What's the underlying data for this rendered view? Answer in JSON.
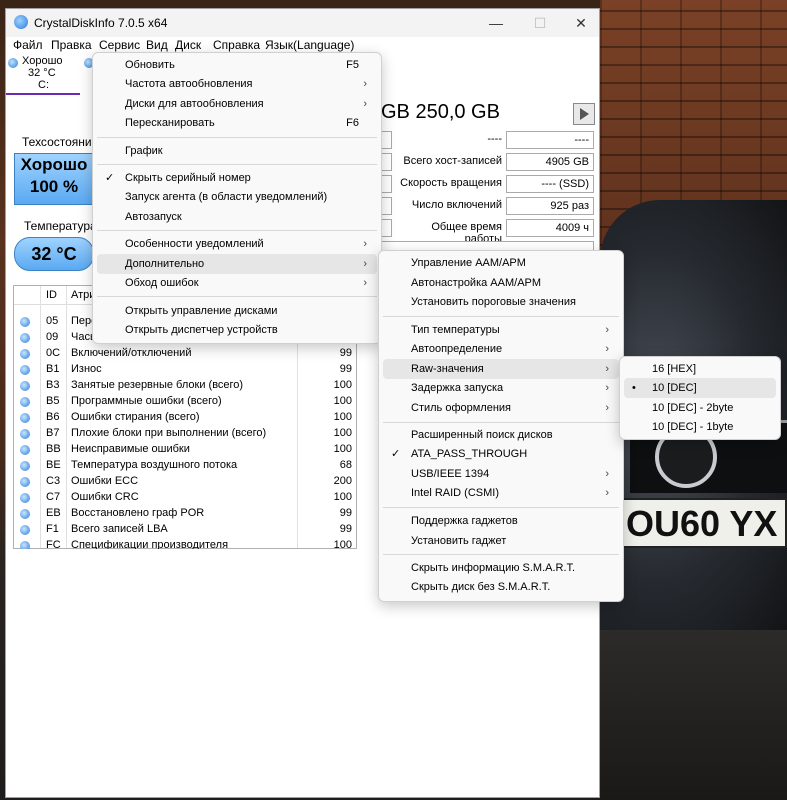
{
  "window": {
    "title": "CrystalDiskInfo 7.0.5 x64",
    "minimize": "—",
    "maximize": "☐",
    "close": "✕"
  },
  "menubar": [
    "Файл",
    "Правка",
    "Сервис",
    "Вид",
    "Диск",
    "Справка",
    "Язык(Language)"
  ],
  "disk_tab": {
    "status": "Хорошо",
    "temp": "32 °C",
    "letter": "C:"
  },
  "disk_header": "GB 250,0 GB",
  "health": {
    "label": "Техсостояние",
    "status": "Хорошо",
    "percent": "100 %"
  },
  "temperature": {
    "label": "Температура",
    "value": "32 °C"
  },
  "info": {
    "r0": {
      "left_value": "----",
      "right_value": "----"
    },
    "host_writes": {
      "label": "Всего хост-записей",
      "value": "4905 GB"
    },
    "rotation": {
      "label": "Скорость вращения",
      "value": "---- (SSD)"
    },
    "power_on_count": {
      "label": "Число включений",
      "value": "925 раз"
    },
    "power_on_hours": {
      "label": "Общее время работы",
      "value": "4009 ч"
    }
  },
  "smart": {
    "headers": {
      "id": "ID",
      "attr": "Атри"
    },
    "rows": [
      {
        "id": "05",
        "name": "Пере",
        "value": ""
      },
      {
        "id": "09",
        "name": "Часы",
        "value": ""
      },
      {
        "id": "0C",
        "name": "Включений/отключений",
        "value": "99"
      },
      {
        "id": "B1",
        "name": "Износ",
        "value": "99"
      },
      {
        "id": "B3",
        "name": "Занятые резервные блоки (всего)",
        "value": "100"
      },
      {
        "id": "B5",
        "name": "Программные ошибки (всего)",
        "value": "100"
      },
      {
        "id": "B6",
        "name": "Ошибки стирания (всего)",
        "value": "100"
      },
      {
        "id": "B7",
        "name": "Плохие блоки при выполнении (всего)",
        "value": "100"
      },
      {
        "id": "BB",
        "name": "Неисправимые ошибки",
        "value": "100"
      },
      {
        "id": "BE",
        "name": "Температура воздушного потока",
        "value": "68"
      },
      {
        "id": "C3",
        "name": "Ошибки ECC",
        "value": "200"
      },
      {
        "id": "C7",
        "name": "Ошибки CRC",
        "value": "100"
      },
      {
        "id": "EB",
        "name": "Восстановлено граф POR",
        "value": "99"
      },
      {
        "id": "F1",
        "name": "Всего записей LBA",
        "value": "99"
      },
      {
        "id": "FC",
        "name": "Спецификации производителя",
        "value": "100"
      }
    ]
  },
  "service_menu": {
    "refresh": "Обновить",
    "refresh_key": "F5",
    "refresh_rate": "Частота автообновления",
    "auto_refresh_disks": "Диски для автообновления",
    "rescan": "Пересканировать",
    "rescan_key": "F6",
    "graph": "График",
    "hide_serial": "Скрыть серийный номер",
    "agent": "Запуск агента (в области уведомлений)",
    "autostart": "Автозапуск",
    "notifications": "Особенности уведомлений",
    "advanced": "Дополнительно",
    "workarounds": "Обход ошибок",
    "disk_mgmt": "Открыть управление дисками",
    "device_mgr": "Открыть диспетчер устройств"
  },
  "advanced_menu": {
    "aam_apm": "Управление AAM/APM",
    "aam_apm_auto": "Автонастройка AAM/APM",
    "thresholds": "Установить пороговые значения",
    "temp_type": "Тип температуры",
    "auto_detect": "Автоопределение",
    "raw_values": "Raw-значения",
    "start_delay": "Задержка запуска",
    "style": "Стиль оформления",
    "advanced_search": "Расширенный поиск дисков",
    "ata_pass": "ATA_PASS_THROUGH",
    "usb": "USB/IEEE 1394",
    "intel_raid": "Intel RAID (CSMI)",
    "gadget_support": "Поддержка гаджетов",
    "install_gadget": "Установить гаджет",
    "hide_smart_info": "Скрыть информацию S.M.A.R.T.",
    "hide_no_smart": "Скрыть диск без S.M.A.R.T."
  },
  "raw_menu": {
    "hex": "16 [HEX]",
    "dec": "10 [DEC]",
    "dec2": "10 [DEC] - 2byte",
    "dec1": "10 [DEC] - 1byte"
  },
  "glyphs": {
    "check": "✓",
    "arrow": "›",
    "bullet": "•"
  },
  "wallpaper": {
    "plate": "OU60 YX"
  }
}
